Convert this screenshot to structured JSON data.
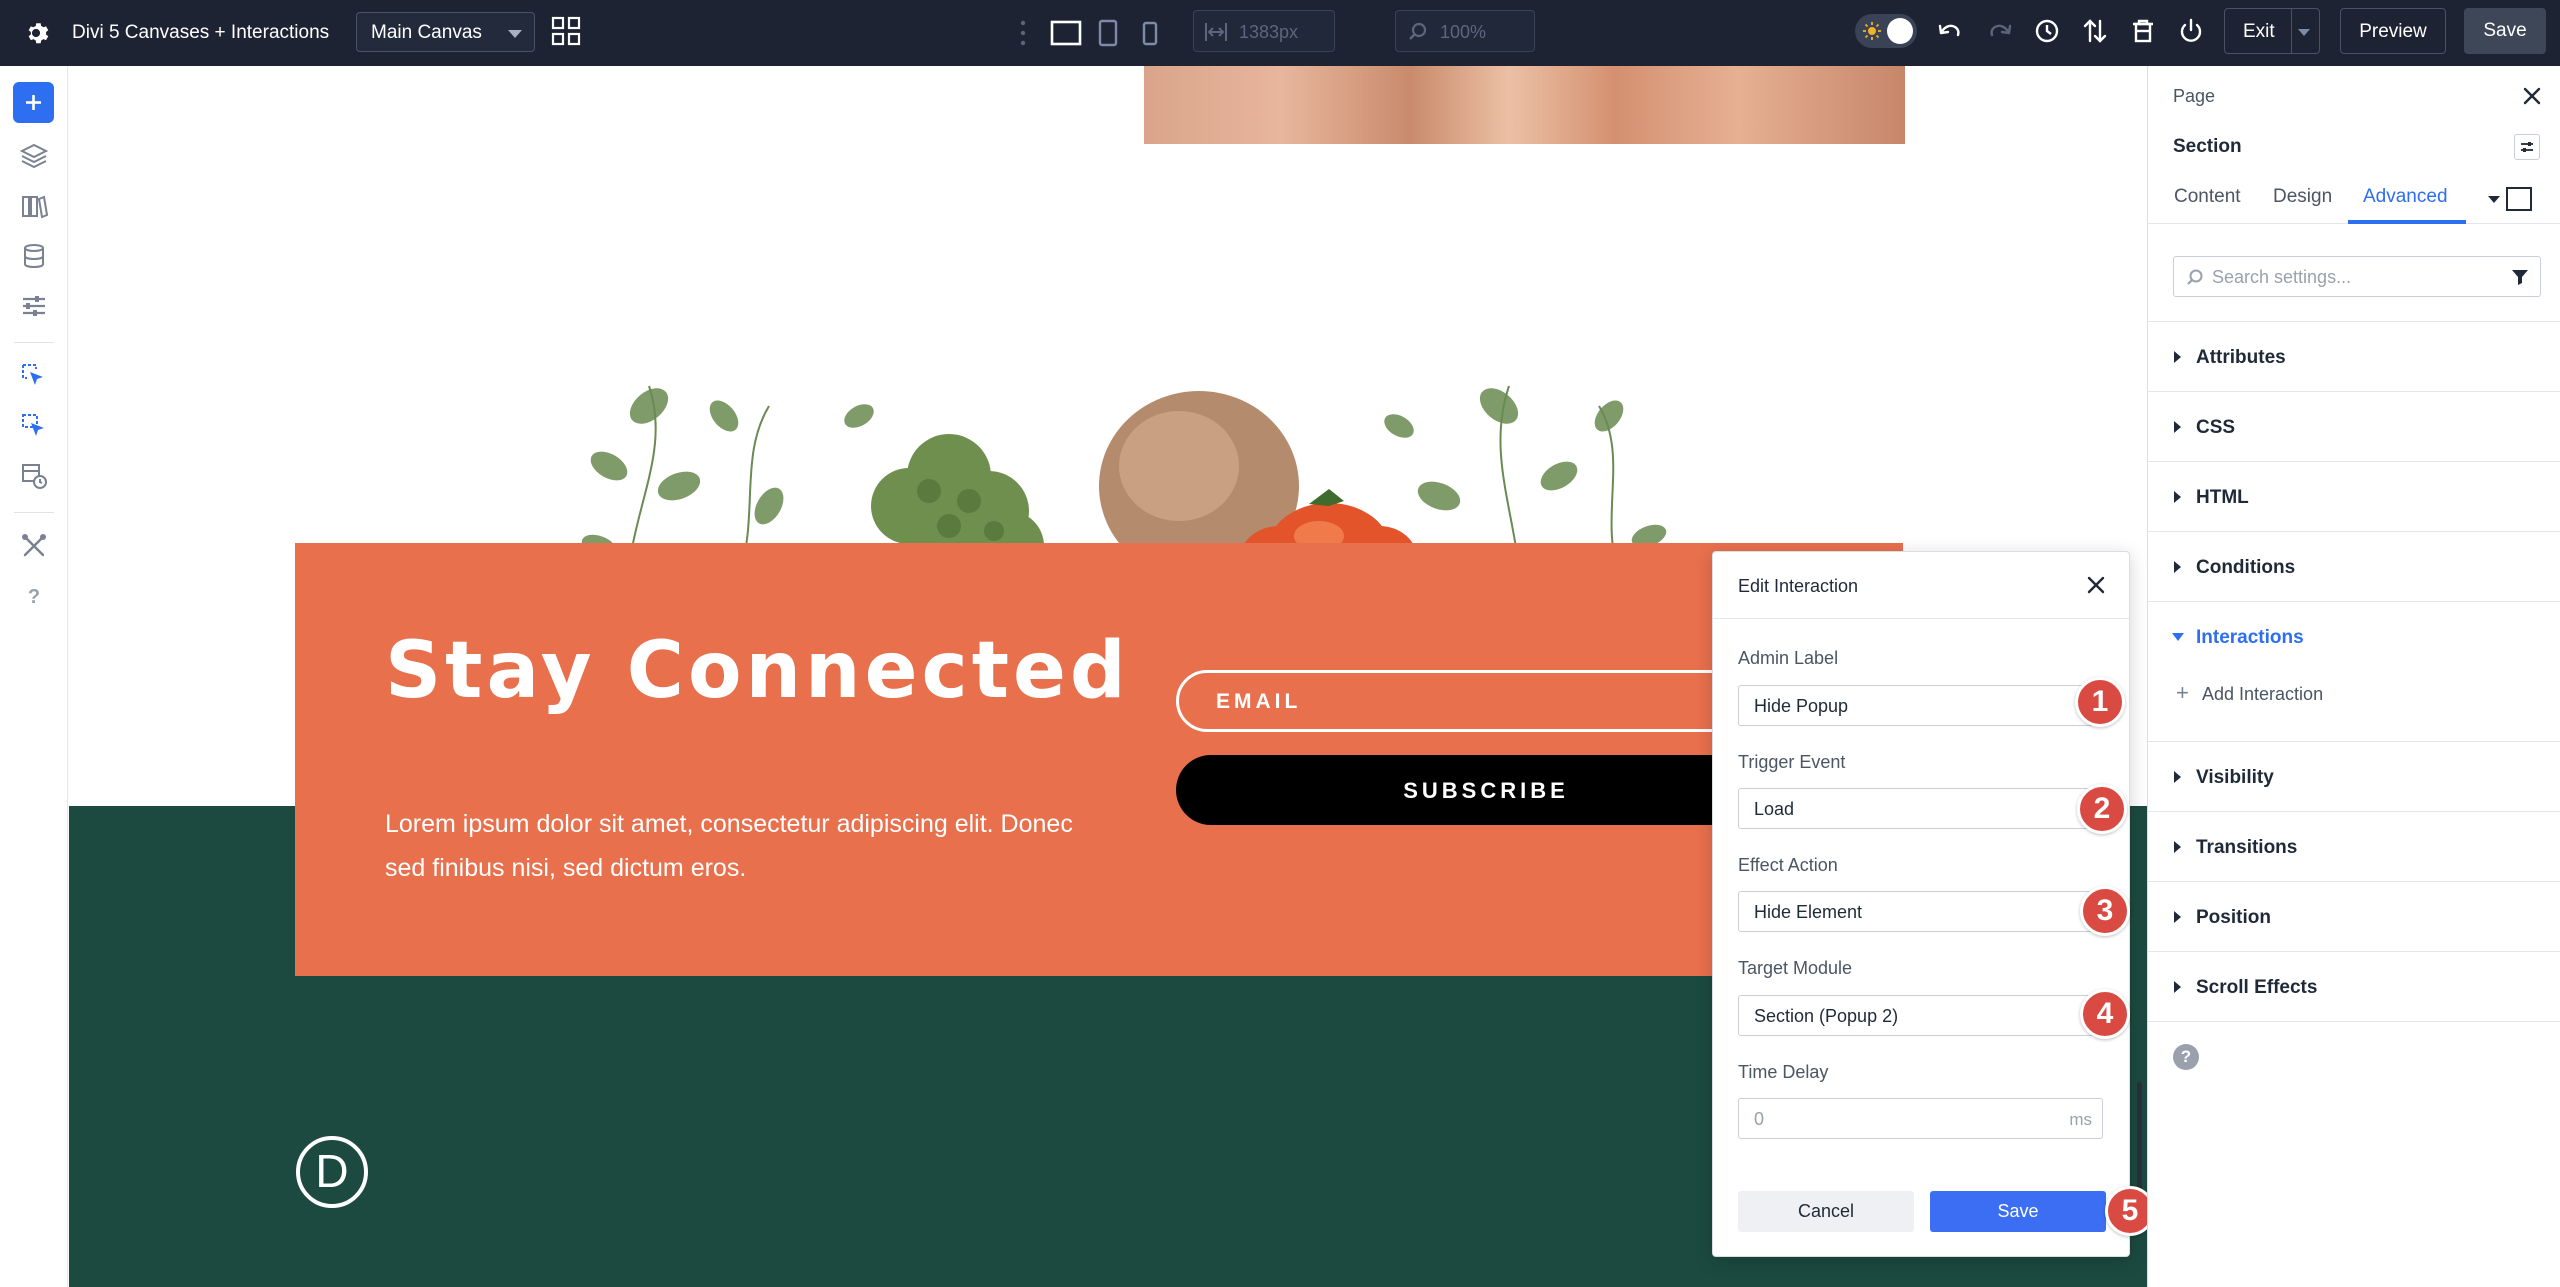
{
  "topbar": {
    "title": "Divi 5 Canvases + Interactions",
    "canvas_select": "Main Canvas",
    "width_value": "1383px",
    "zoom_value": "100%",
    "exit_label": "Exit",
    "preview_label": "Preview",
    "save_label": "Save"
  },
  "canvas": {
    "heading": "Stay Connected",
    "body_text": "Lorem ipsum dolor sit amet, consectetur adipiscing elit. Donec sed finibus nisi, sed dictum eros.",
    "email_placeholder": "EMAIL",
    "subscribe_label": "SUBSCRIBE",
    "logo_letter": "D"
  },
  "modal": {
    "title": "Edit Interaction",
    "fields": [
      {
        "label": "Admin Label",
        "value": "Hide Popup"
      },
      {
        "label": "Trigger Event",
        "value": "Load"
      },
      {
        "label": "Effect Action",
        "value": "Hide Element"
      },
      {
        "label": "Target Module",
        "value": "Section (Popup 2)"
      },
      {
        "label": "Time Delay",
        "value": "0",
        "unit": "ms"
      }
    ],
    "cancel_label": "Cancel",
    "save_label": "Save",
    "badges": [
      "1",
      "2",
      "3",
      "4",
      "5"
    ]
  },
  "panel": {
    "breadcrumb": "Page",
    "element": "Section",
    "tabs": [
      "Content",
      "Design",
      "Advanced"
    ],
    "active_tab": "Advanced",
    "search_placeholder": "Search settings...",
    "groups": [
      "Attributes",
      "CSS",
      "HTML",
      "Conditions",
      "Interactions",
      "Visibility",
      "Transitions",
      "Position",
      "Scroll Effects"
    ],
    "open_group": "Interactions",
    "add_interaction_label": "Add Interaction",
    "help_glyph": "?"
  },
  "colors": {
    "topbar_bg": "#1d2333",
    "accent": "#2e6ef0",
    "card_orange": "#e8704d",
    "dark_green": "#1c4a40",
    "badge_red": "#d94a43"
  }
}
